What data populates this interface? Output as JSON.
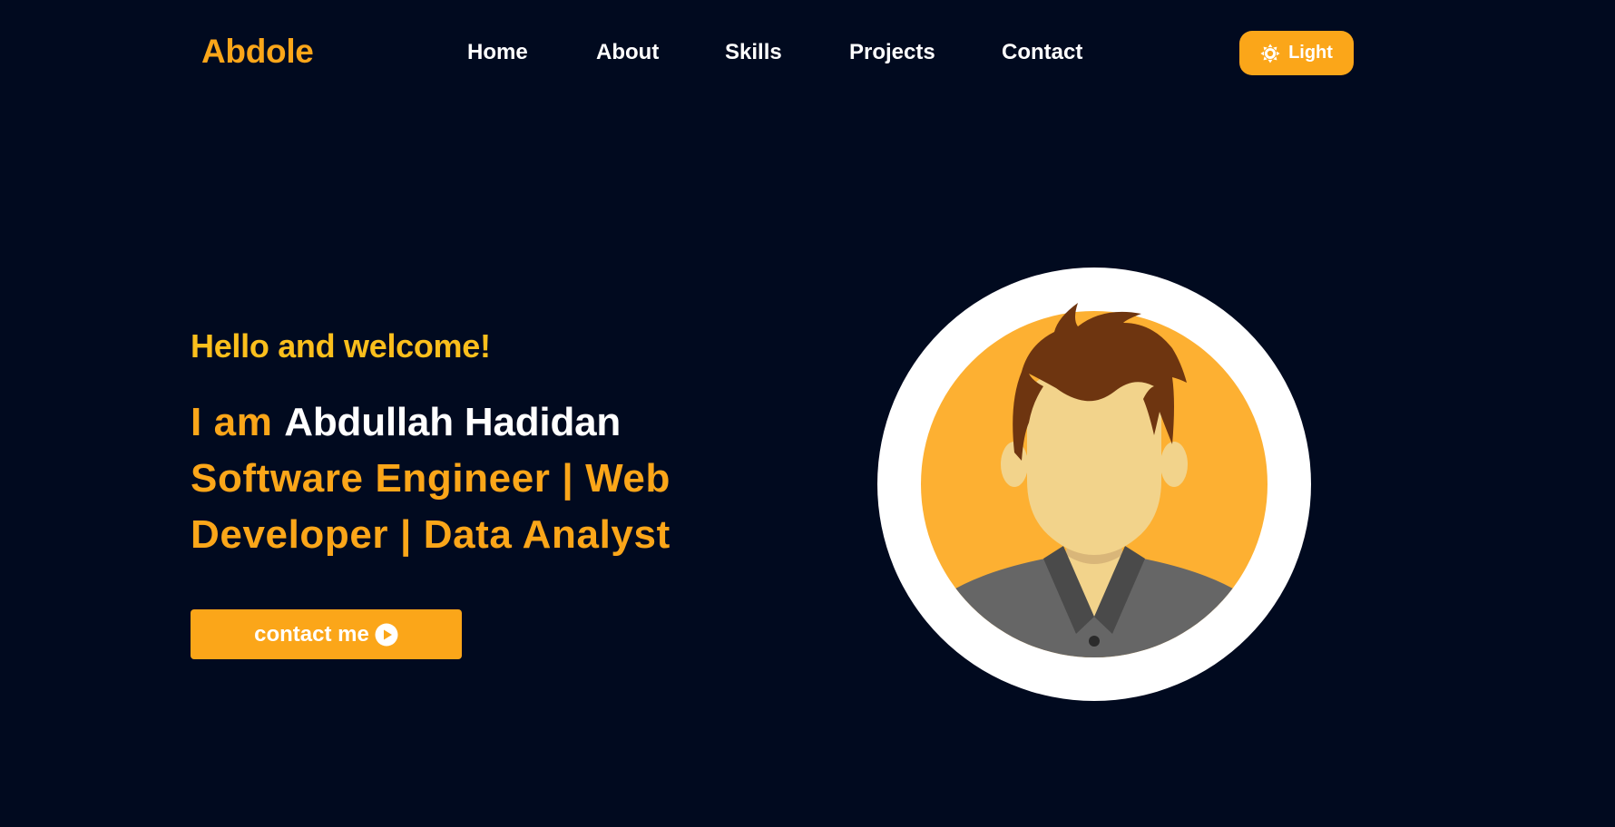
{
  "header": {
    "logo": "Abdole",
    "nav": [
      {
        "label": "Home"
      },
      {
        "label": "About"
      },
      {
        "label": "Skills"
      },
      {
        "label": "Projects"
      },
      {
        "label": "Contact"
      }
    ],
    "theme_toggle": {
      "label": "Light",
      "icon": "sun-icon"
    }
  },
  "hero": {
    "greeting": "Hello and welcome!",
    "intro_prefix": "I am",
    "name": "Abdullah Hadidan",
    "roles": "Software Engineer | Web Developer | Data Analyst",
    "cta": {
      "label": "contact me",
      "icon": "play-circle-icon"
    }
  },
  "avatar": {
    "icon": "profile-avatar-illustration"
  },
  "colors": {
    "background": "#010a1f",
    "accent": "#fba619",
    "greeting": "#fbbf1c",
    "text": "#ffffff"
  }
}
